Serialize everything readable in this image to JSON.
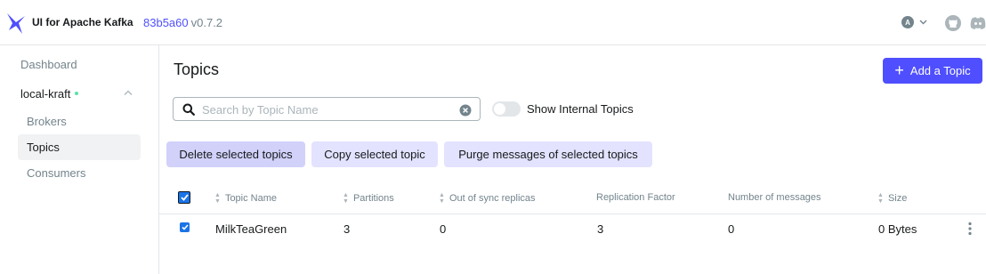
{
  "header": {
    "brand": "UI for Apache Kafka",
    "commit": "83b5a60",
    "version": "v0.7.2",
    "user_initial": "A"
  },
  "sidebar": {
    "dashboard": "Dashboard",
    "cluster": "local-kraft",
    "items": [
      {
        "label": "Brokers"
      },
      {
        "label": "Topics",
        "active": true
      },
      {
        "label": "Consumers"
      }
    ]
  },
  "page": {
    "title": "Topics",
    "add_button": "Add a Topic"
  },
  "search": {
    "placeholder": "Search by Topic Name",
    "value": ""
  },
  "toggle": {
    "label": "Show Internal Topics",
    "on": false
  },
  "actions": {
    "delete": "Delete selected topics",
    "copy": "Copy selected topic",
    "purge": "Purge messages of selected topics"
  },
  "table": {
    "columns": [
      "Topic Name",
      "Partitions",
      "Out of sync replicas",
      "Replication Factor",
      "Number of messages",
      "Size"
    ],
    "rows": [
      {
        "name": "MilkTeaGreen",
        "partitions": "3",
        "out_of_sync": "0",
        "replication_factor": "3",
        "messages": "0",
        "size": "0 Bytes",
        "selected": true
      }
    ]
  },
  "colors": {
    "accent": "#4F4FFF",
    "action_bg": "#E3E3FF",
    "checkbox": "#1A73E8"
  }
}
